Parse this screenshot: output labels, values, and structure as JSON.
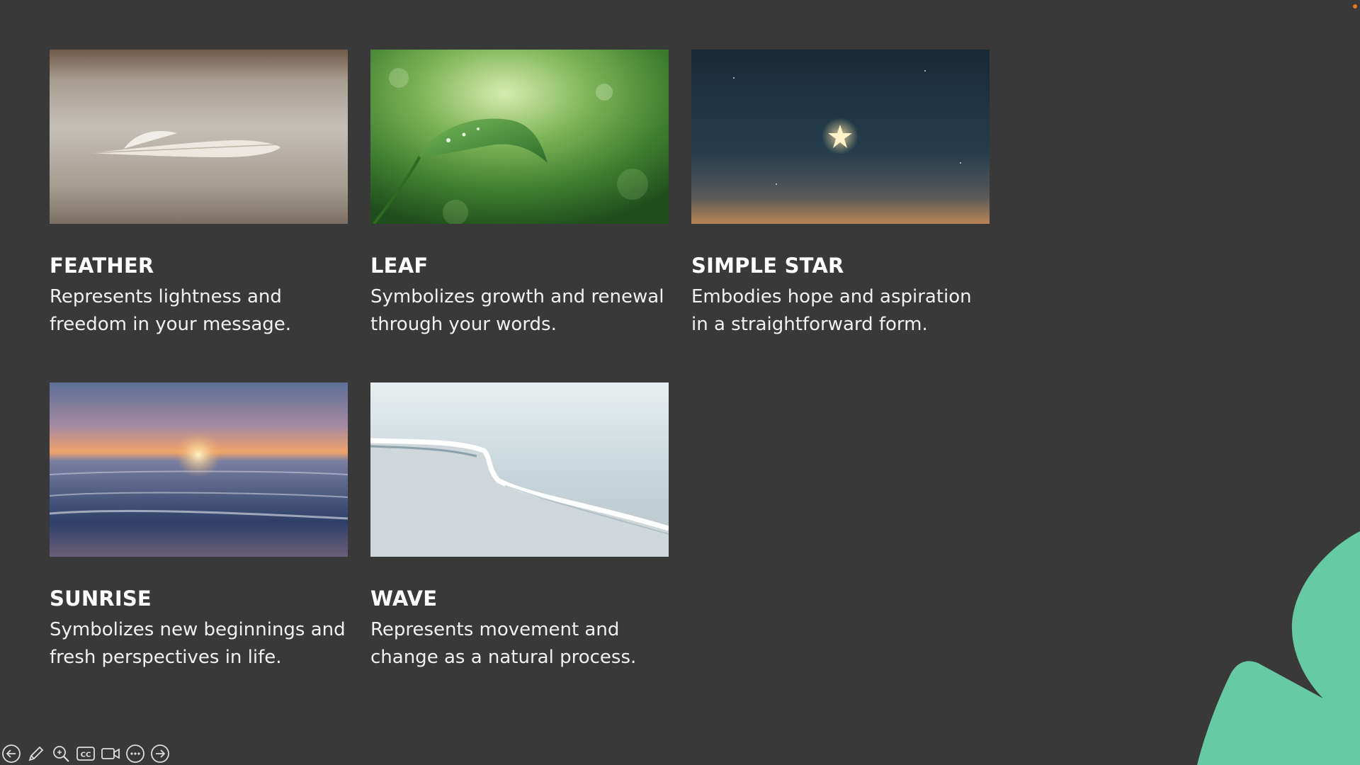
{
  "cards": [
    {
      "title": "FEATHER",
      "description": "Represents lightness and freedom in your message."
    },
    {
      "title": "LEAF",
      "description": "Symbolizes growth and renewal through your words."
    },
    {
      "title": "SIMPLE STAR",
      "description": "Embodies hope and aspiration in a straightforward form."
    },
    {
      "title": "SUNRISE",
      "description": "Symbolizes new beginnings and fresh perspectives in life."
    },
    {
      "title": "WAVE",
      "description": "Represents movement and change as a natural process."
    }
  ],
  "toolbar": {
    "icons": [
      "previous-slide-icon",
      "pen-icon",
      "zoom-icon",
      "closed-captions-icon",
      "video-icon",
      "more-options-icon",
      "next-slide-icon"
    ],
    "captions_label": "CC"
  },
  "colors": {
    "background": "#393939",
    "accent_blob": "#66cba4",
    "text": "#ffffff",
    "corner_dot": "#e07a24"
  }
}
